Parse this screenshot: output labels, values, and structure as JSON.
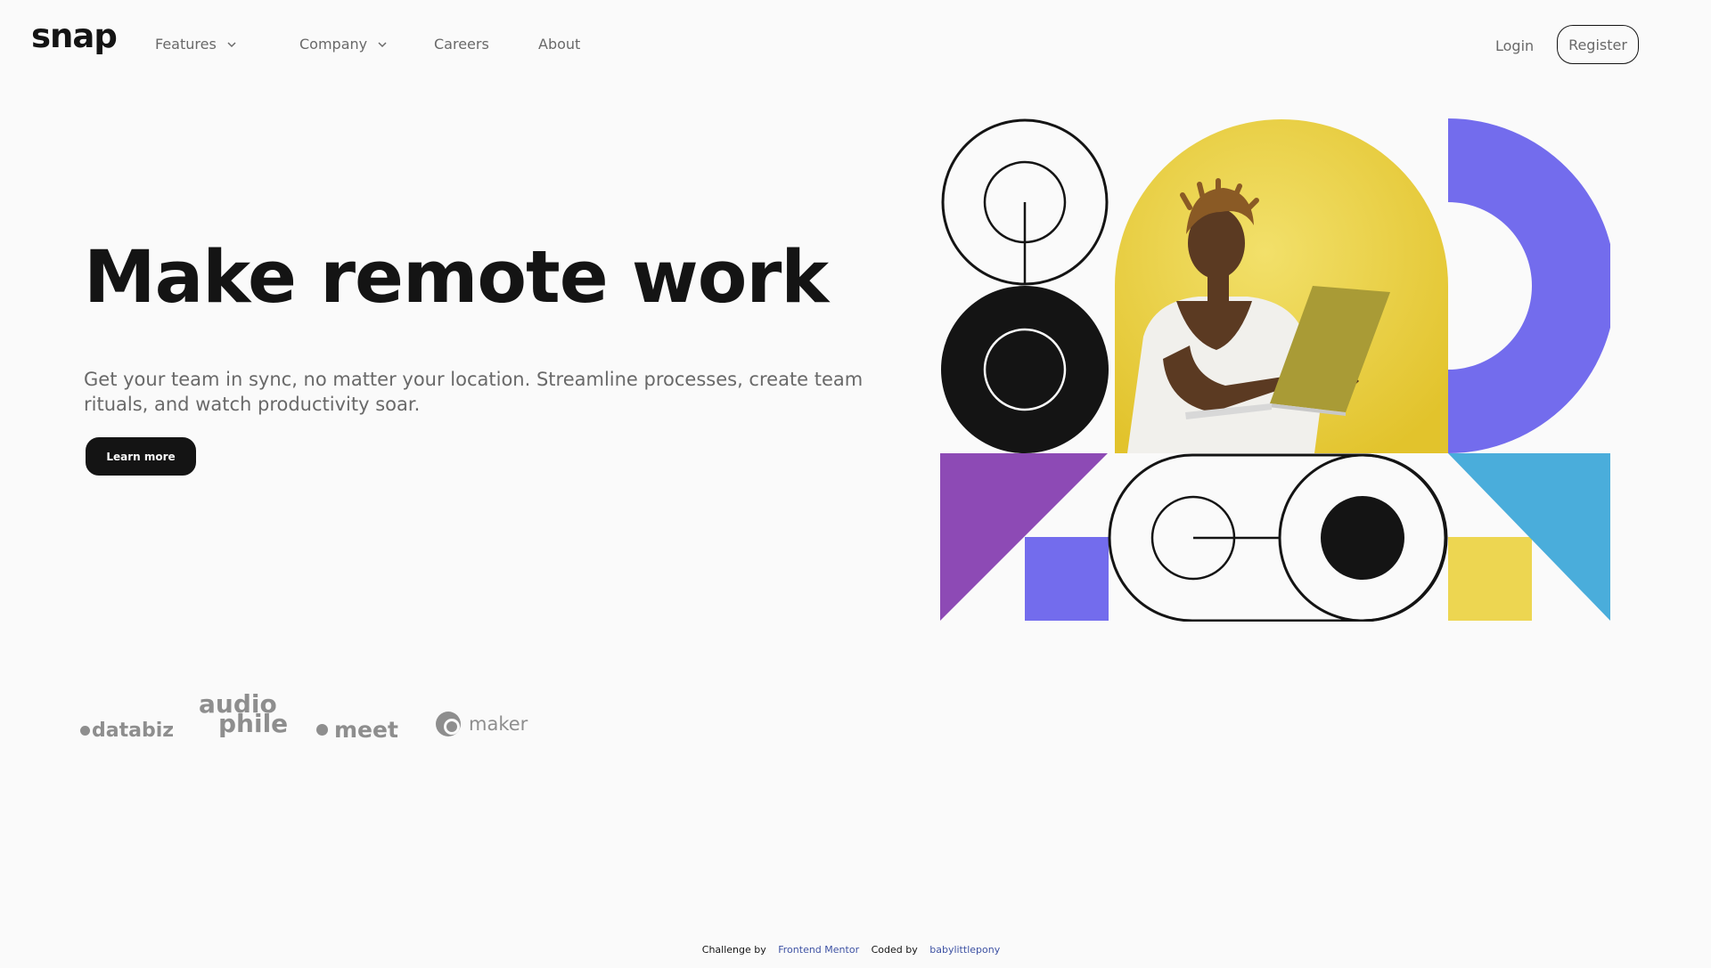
{
  "header": {
    "logo": "snap",
    "nav": {
      "features": "Features",
      "company": "Company",
      "careers": "Careers",
      "about": "About"
    },
    "login": "Login",
    "register": "Register"
  },
  "hero": {
    "title": "Make remote work",
    "description": "Get your team in sync, no matter your location. Streamline processes, create team rituals, and watch productivity soar.",
    "cta": "Learn more"
  },
  "clients": {
    "databiz": "databiz",
    "audiophile_line1": "audio",
    "audiophile_line2": "phile",
    "meet": "meet",
    "maker": "maker"
  },
  "attribution": {
    "challenge_label": "Challenge by",
    "challenge_link": "Frontend Mentor",
    "coded_label": "Coded by",
    "coded_link": "babylittlepony"
  },
  "colors": {
    "background": "#fafafa",
    "text_dark": "#141414",
    "text_gray": "#696969",
    "logo_gray": "#8e8e8e",
    "purple": "#736ced",
    "violet": "#8d4ab5",
    "yellow": "#edd651",
    "cyan": "#4aaddb"
  },
  "icons": {
    "dropdown": "chevron-down-icon"
  }
}
